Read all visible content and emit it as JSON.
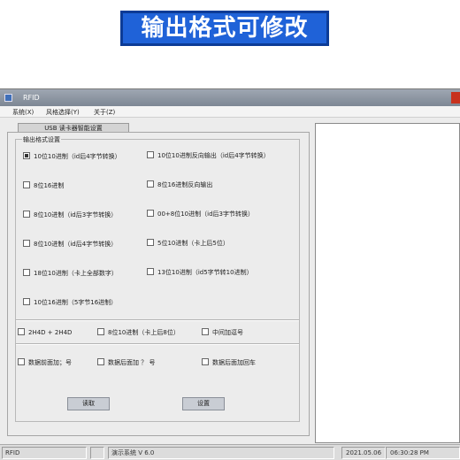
{
  "banner": {
    "text": "输出格式可修改"
  },
  "window": {
    "title": "RFID",
    "menu": [
      "系统(X)",
      "风格选择(Y)",
      "关于(Z)"
    ]
  },
  "tab": {
    "label": "USB 读卡器智能设置"
  },
  "group": {
    "title": "输出格式设置",
    "options_left": [
      {
        "label": "10位10进制（id后4字节转换）",
        "checked": true
      },
      {
        "label": "8位16进制",
        "checked": false
      },
      {
        "label": "8位10进制（id后3字节转换）",
        "checked": false
      },
      {
        "label": "8位10进制（id后4字节转换）",
        "checked": false
      },
      {
        "label": "18位10进制（卡上全部数字）",
        "checked": false
      },
      {
        "label": "10位16进制（5字节16进制）",
        "checked": false
      }
    ],
    "options_right": [
      {
        "label": "10位10进制反向输出（id后4字节转换）",
        "checked": false
      },
      {
        "label": "8位16进制反向输出",
        "checked": false
      },
      {
        "label": "00+8位10进制（id后3字节转换）",
        "checked": false
      },
      {
        "label": "5位10进制（卡上后5位）",
        "checked": false
      },
      {
        "label": "13位10进制（id5字节转10进制）",
        "checked": false
      }
    ],
    "row_extra": [
      {
        "label": "2H4D + 2H4D",
        "checked": false
      },
      {
        "label": "8位10进制（卡上后8位）",
        "checked": false
      },
      {
        "label": "中间加逗号",
        "checked": false
      }
    ],
    "row_suffix": [
      {
        "label": "数据前面加；号",
        "checked": false
      },
      {
        "label": "数据后面加 ？ 号",
        "checked": false
      },
      {
        "label": "数据后面加回车",
        "checked": false
      }
    ]
  },
  "buttons": {
    "read": "读取",
    "set": "设置"
  },
  "status": {
    "app": "RFID",
    "demo": "演示系统  V 6.0",
    "date": "2021.05.06",
    "time": "06:30:28 PM"
  }
}
